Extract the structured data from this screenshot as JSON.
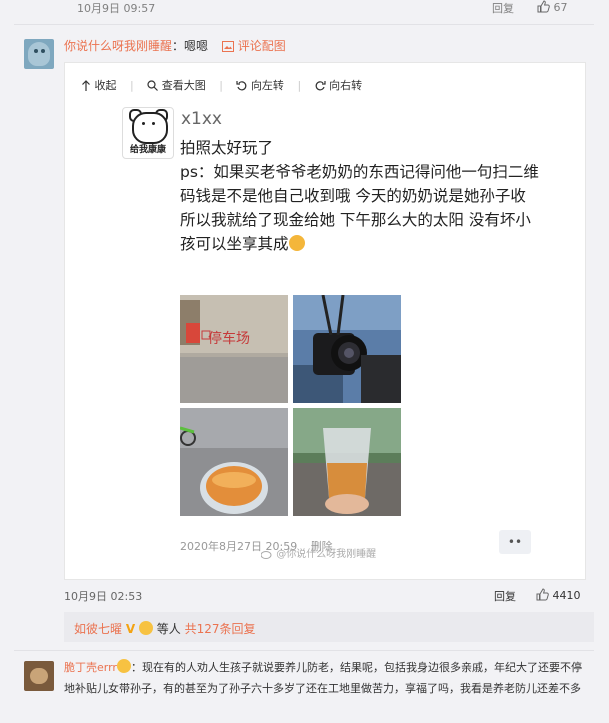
{
  "prev_comment": {
    "time": "10月9日 09:57",
    "reply_label": "回复",
    "like_count": "67"
  },
  "comment1": {
    "username": "你说什么呀我刚睡醒",
    "text": "：嗯嗯",
    "pic_label": "评论配图",
    "card": {
      "toolbar": {
        "collapse": "收起",
        "view_large": "查看大图",
        "rotate_left": "向左转",
        "rotate_right": "向右转"
      },
      "avatar_text": "给我康康",
      "author": "x1xx",
      "body": "拍照太好玩了\nps：如果买老爷爷老奶奶的东西记得问他一句扫二维码钱是不是他自己收到哦 今天的奶奶说是她孙子收 所以我就给了现金给她 下午那么大的太阳 没有坏小孩可以坐享其成",
      "photo_sign": "停车场",
      "post_time": "2020年8月27日 20:59",
      "delete_label": "删除",
      "more_label": "••",
      "watermark": "@你说什么呀我刚睡醒"
    },
    "time": "10月9日 02:53",
    "reply_label": "回复",
    "like_count": "4410",
    "sub_summary": {
      "names": "如彼七曜",
      "etc": "等人",
      "count": "共127条回复"
    }
  },
  "comment2": {
    "username": "脆丁壳errr",
    "text": "：现在有的人劝人生孩子就说要养儿防老，结果呢，包括我身边很多亲戚，年纪大了还要不停地补贴儿女带孙子，有的甚至为了孙子六十多岁了还在工地里做苦力，享福了吗，我看是养老防儿还差不多"
  },
  "colors": {
    "accent": "#eb7350",
    "background": "#f2f2f5"
  }
}
